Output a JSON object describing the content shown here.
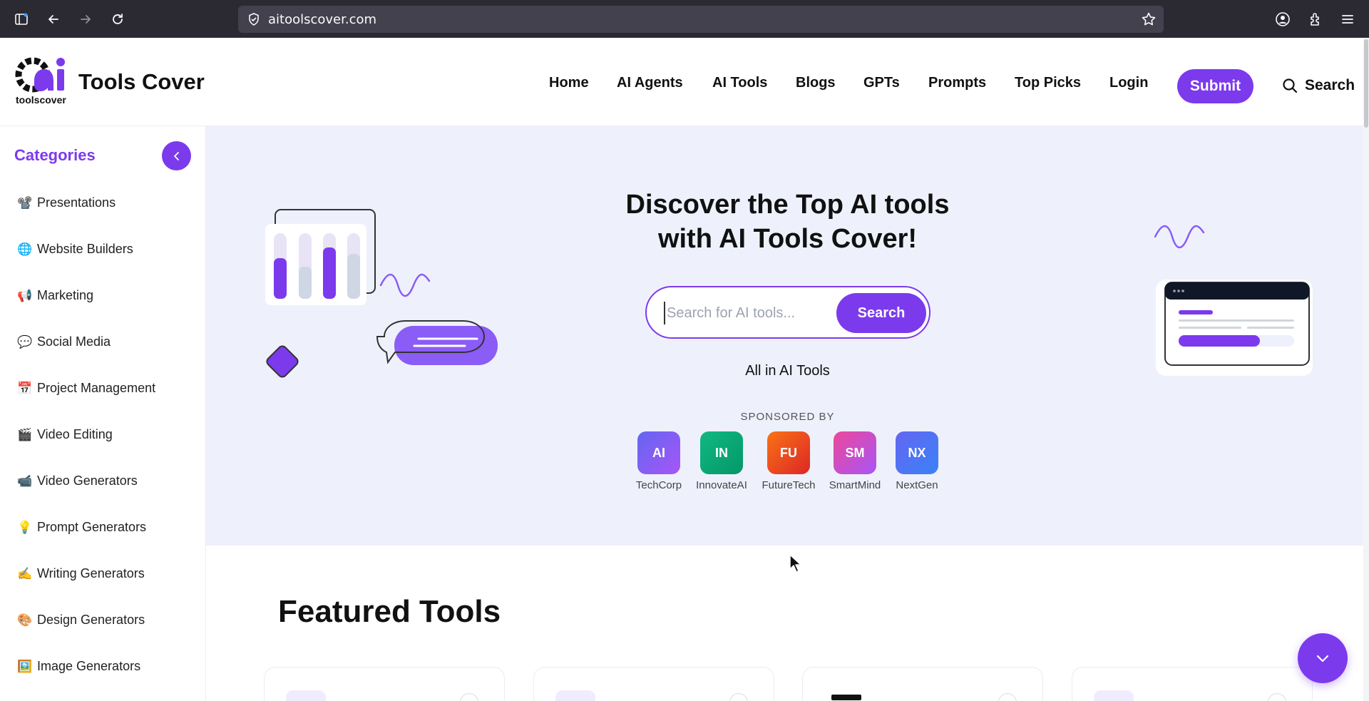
{
  "browser": {
    "url": "aitoolscover.com",
    "icons": [
      "sidebar-icon",
      "back-icon",
      "forward-icon",
      "reload-icon",
      "shield-icon",
      "star-icon",
      "account-icon",
      "extensions-icon",
      "menu-icon"
    ]
  },
  "header": {
    "logo_sub": "toolscover",
    "brand": "Tools Cover",
    "nav": [
      "Home",
      "AI Agents",
      "AI Tools",
      "Blogs",
      "GPTs",
      "Prompts",
      "Top Picks",
      "Login"
    ],
    "submit_label": "Submit",
    "search_label": "Search"
  },
  "sidebar": {
    "title": "Categories",
    "items": [
      {
        "emoji": "📽️",
        "label": "Presentations"
      },
      {
        "emoji": "🌐",
        "label": "Website Builders"
      },
      {
        "emoji": "📢",
        "label": "Marketing"
      },
      {
        "emoji": "💬",
        "label": "Social Media"
      },
      {
        "emoji": "📅",
        "label": "Project Management"
      },
      {
        "emoji": "🎬",
        "label": "Video Editing"
      },
      {
        "emoji": "📹",
        "label": "Video Generators"
      },
      {
        "emoji": "💡",
        "label": "Prompt Generators"
      },
      {
        "emoji": "✍️",
        "label": "Writing Generators"
      },
      {
        "emoji": "🎨",
        "label": "Design Generators"
      },
      {
        "emoji": "🖼️",
        "label": "Image Generators"
      }
    ]
  },
  "hero": {
    "title_line1": "Discover the Top AI tools",
    "title_line2": "with AI Tools Cover!",
    "search_placeholder": "Search for AI tools...",
    "search_button": "Search",
    "tagline": "All in AI Tools",
    "sponsored_label": "SPONSORED BY",
    "sponsors": [
      {
        "code": "AI",
        "name": "TechCorp",
        "color_from": "#6366f1",
        "color_to": "#a855f7"
      },
      {
        "code": "IN",
        "name": "InnovateAI",
        "color_from": "#10b981",
        "color_to": "#059669"
      },
      {
        "code": "FU",
        "name": "FutureTech",
        "color_from": "#f97316",
        "color_to": "#dc2626"
      },
      {
        "code": "SM",
        "name": "SmartMind",
        "color_from": "#ec4899",
        "color_to": "#a855f7"
      },
      {
        "code": "NX",
        "name": "NextGen",
        "color_from": "#6366f1",
        "color_to": "#3b82f6"
      }
    ]
  },
  "featured": {
    "title": "Featured Tools"
  },
  "colors": {
    "accent": "#7c3aed",
    "hero_bg": "#eef1fc"
  }
}
